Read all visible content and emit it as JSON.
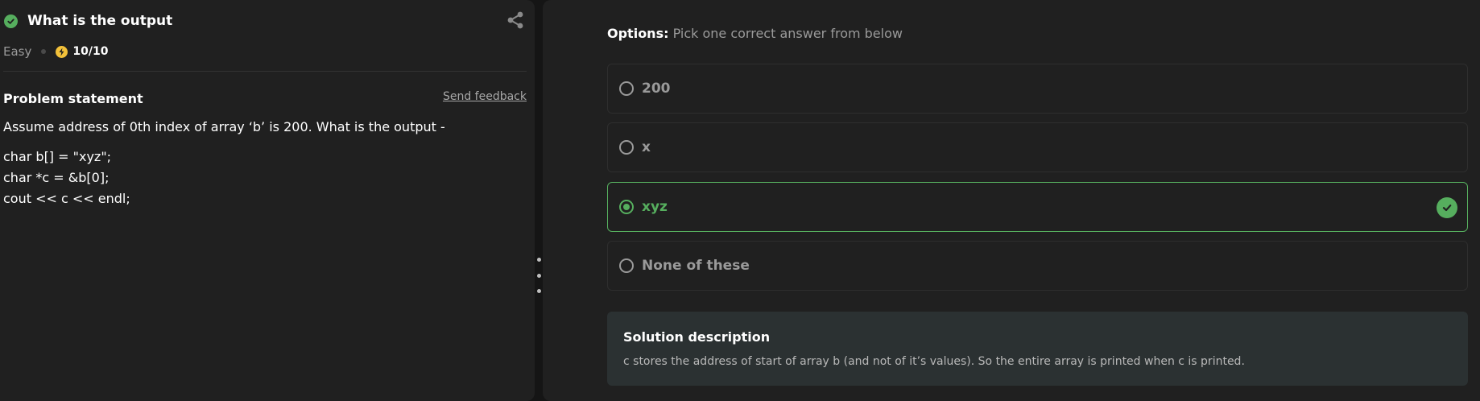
{
  "question": {
    "title": "What is the output",
    "difficulty": "Easy",
    "score": "10/10"
  },
  "problem": {
    "heading": "Problem statement",
    "feedback_label": "Send feedback",
    "statement": "Assume address of 0th index of array ‘b’ is 200. What is the output -",
    "code_lines": [
      "char b[] = \"xyz\";",
      "char *c = &b[0];",
      "cout << c << endl;"
    ]
  },
  "options": {
    "label": "Options:",
    "instruction": "Pick one correct answer from below",
    "items": [
      {
        "text": "200",
        "selected": false
      },
      {
        "text": "x",
        "selected": false
      },
      {
        "text": "xyz",
        "selected": true
      },
      {
        "text": "None of these",
        "selected": false
      }
    ]
  },
  "solution": {
    "title": "Solution description",
    "text": "c stores the address of start of array b (and not of it’s values). So the entire array is printed when c is printed."
  },
  "icons": {
    "solved": "check-circle-icon",
    "share": "share-icon",
    "points": "lightning-bolt-icon",
    "correct": "check-circle-icon",
    "drag": "vertical-dots-icon"
  },
  "colors": {
    "accent_green": "#56ae5e",
    "bolt_yellow": "#f3c13a",
    "panel_bg": "#202020",
    "solution_bg": "#2b3132"
  }
}
